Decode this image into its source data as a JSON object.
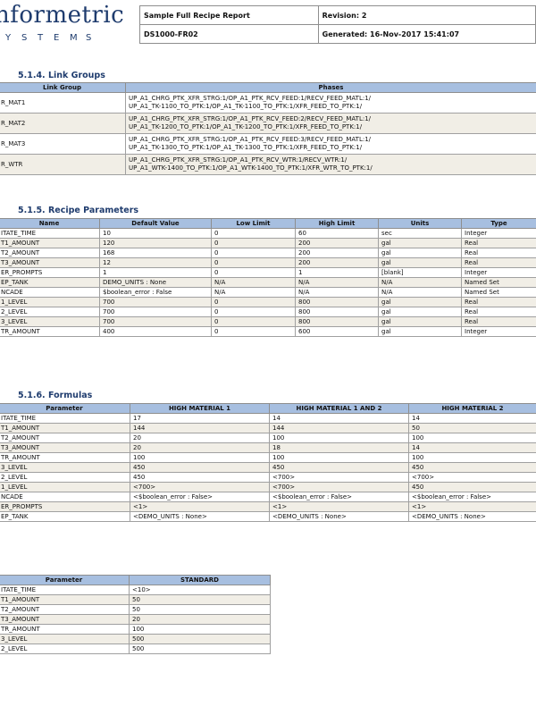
{
  "logo": {
    "main": "nformetric",
    "sub": [
      "Y",
      "S",
      "T",
      "E",
      "M",
      "S"
    ]
  },
  "header": {
    "report_title": "Sample Full Recipe Report",
    "revision": "Revision: 2",
    "doc_id": "DS1000-FR02",
    "generated": "Generated: 16-Nov-2017 15:41:07"
  },
  "link_groups": {
    "title": "5.1.4.  Link Groups",
    "headers": [
      "Link Group",
      "Phases"
    ],
    "rows": [
      [
        "R_MAT1",
        "UP_A1_CHRG_PTK_XFR_STRG:1/OP_A1_PTK_RCV_FEED:1/RECV_FEED_MATL:1/",
        "UP_A1_TK-1100_TO_PTK:1/OP_A1_TK-1100_TO_PTK:1/XFR_FEED_TO_PTK:1/"
      ],
      [
        "R_MAT2",
        "UP_A1_CHRG_PTK_XFR_STRG:1/OP_A1_PTK_RCV_FEED:2/RECV_FEED_MATL:1/",
        "UP_A1_TK-1200_TO_PTK:1/OP_A1_TK-1200_TO_PTK:1/XFR_FEED_TO_PTK:1/"
      ],
      [
        "R_MAT3",
        "UP_A1_CHRG_PTK_XFR_STRG:1/OP_A1_PTK_RCV_FEED:3/RECV_FEED_MATL:1/",
        "UP_A1_TK-1300_TO_PTK:1/OP_A1_TK-1300_TO_PTK:1/XFR_FEED_TO_PTK:1/"
      ],
      [
        "R_WTR",
        "UP_A1_CHRG_PTK_XFR_STRG:1/OP_A1_PTK_RCV_WTR:1/RECV_WTR:1/",
        "UP_A1_WTK-1400_TO_PTK:1/OP_A1_WTK-1400_TO_PTK:1/XFR_WTR_TO_PTK:1/"
      ]
    ]
  },
  "recipe_parameters": {
    "title": "5.1.5.  Recipe Parameters",
    "headers": [
      "Name",
      "Default Value",
      "Low Limit",
      "High Limit",
      "Units",
      "Type"
    ],
    "rows": [
      [
        "ITATE_TIME",
        "10",
        "0",
        "60",
        "sec",
        "Integer"
      ],
      [
        "T1_AMOUNT",
        "120",
        "0",
        "200",
        "gal",
        "Real"
      ],
      [
        "T2_AMOUNT",
        "168",
        "0",
        "200",
        "gal",
        "Real"
      ],
      [
        "T3_AMOUNT",
        "12",
        "0",
        "200",
        "gal",
        "Real"
      ],
      [
        "ER_PROMPTS",
        "1",
        "0",
        "1",
        "[blank]",
        "Integer"
      ],
      [
        "EP_TANK",
        "DEMO_UNITS : None",
        "N/A",
        "N/A",
        "N/A",
        "Named Set"
      ],
      [
        "NCADE",
        "$boolean_error : False",
        "N/A",
        "N/A",
        "N/A",
        "Named Set"
      ],
      [
        "1_LEVEL",
        "700",
        "0",
        "800",
        "gal",
        "Real"
      ],
      [
        "2_LEVEL",
        "700",
        "0",
        "800",
        "gal",
        "Real"
      ],
      [
        "3_LEVEL",
        "700",
        "0",
        "800",
        "gal",
        "Real"
      ],
      [
        "TR_AMOUNT",
        "400",
        "0",
        "600",
        "gal",
        "Integer"
      ]
    ]
  },
  "formulas": {
    "title": "5.1.6.  Formulas",
    "headers": [
      "Parameter",
      "HIGH MATERIAL 1",
      "HIGH MATERIAL 1 AND 2",
      "HIGH MATERIAL 2"
    ],
    "rows": [
      [
        "ITATE_TIME",
        "17",
        "14",
        "14"
      ],
      [
        "T1_AMOUNT",
        "144",
        "144",
        "50"
      ],
      [
        "T2_AMOUNT",
        "20",
        "100",
        "100"
      ],
      [
        "T3_AMOUNT",
        "20",
        "18",
        "14"
      ],
      [
        "TR_AMOUNT",
        "100",
        "100",
        "100"
      ],
      [
        "3_LEVEL",
        "450",
        "450",
        "450"
      ],
      [
        "2_LEVEL",
        "450",
        "<700>",
        "<700>"
      ],
      [
        "1_LEVEL",
        "<700>",
        "<700>",
        "450"
      ],
      [
        "NCADE",
        "<$boolean_error : False>",
        "<$boolean_error : False>",
        "<$boolean_error : False>"
      ],
      [
        "ER_PROMPTS",
        "<1>",
        "<1>",
        "<1>"
      ],
      [
        "EP_TANK",
        "<DEMO_UNITS : None>",
        "<DEMO_UNITS : None>",
        "<DEMO_UNITS : None>"
      ]
    ]
  },
  "standard": {
    "headers": [
      "Parameter",
      "STANDARD"
    ],
    "rows": [
      [
        "ITATE_TIME",
        "<10>"
      ],
      [
        "T1_AMOUNT",
        "50"
      ],
      [
        "T2_AMOUNT",
        "50"
      ],
      [
        "T3_AMOUNT",
        "20"
      ],
      [
        "TR_AMOUNT",
        "100"
      ],
      [
        "3_LEVEL",
        "500"
      ],
      [
        "2_LEVEL",
        "500"
      ]
    ]
  }
}
